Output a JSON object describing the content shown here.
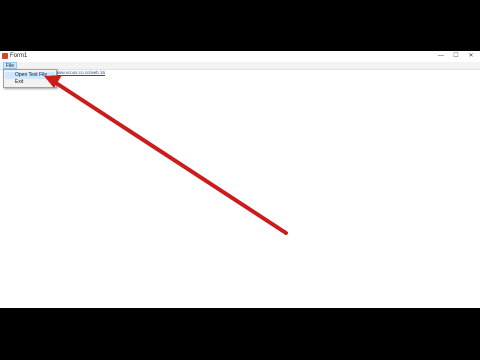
{
  "window": {
    "title": "Form1",
    "controls": {
      "minimize": "—",
      "maximize": "☐",
      "close": "✕"
    }
  },
  "menubar": {
    "file_label": "File"
  },
  "file_menu": {
    "items": [
      {
        "label": "Open Text File"
      },
      {
        "label": "Exit"
      }
    ]
  },
  "content": {
    "link_text": "www.vcoos.co.cc/web 16"
  },
  "annotation": {
    "arrow_color": "#cc1b1b"
  }
}
